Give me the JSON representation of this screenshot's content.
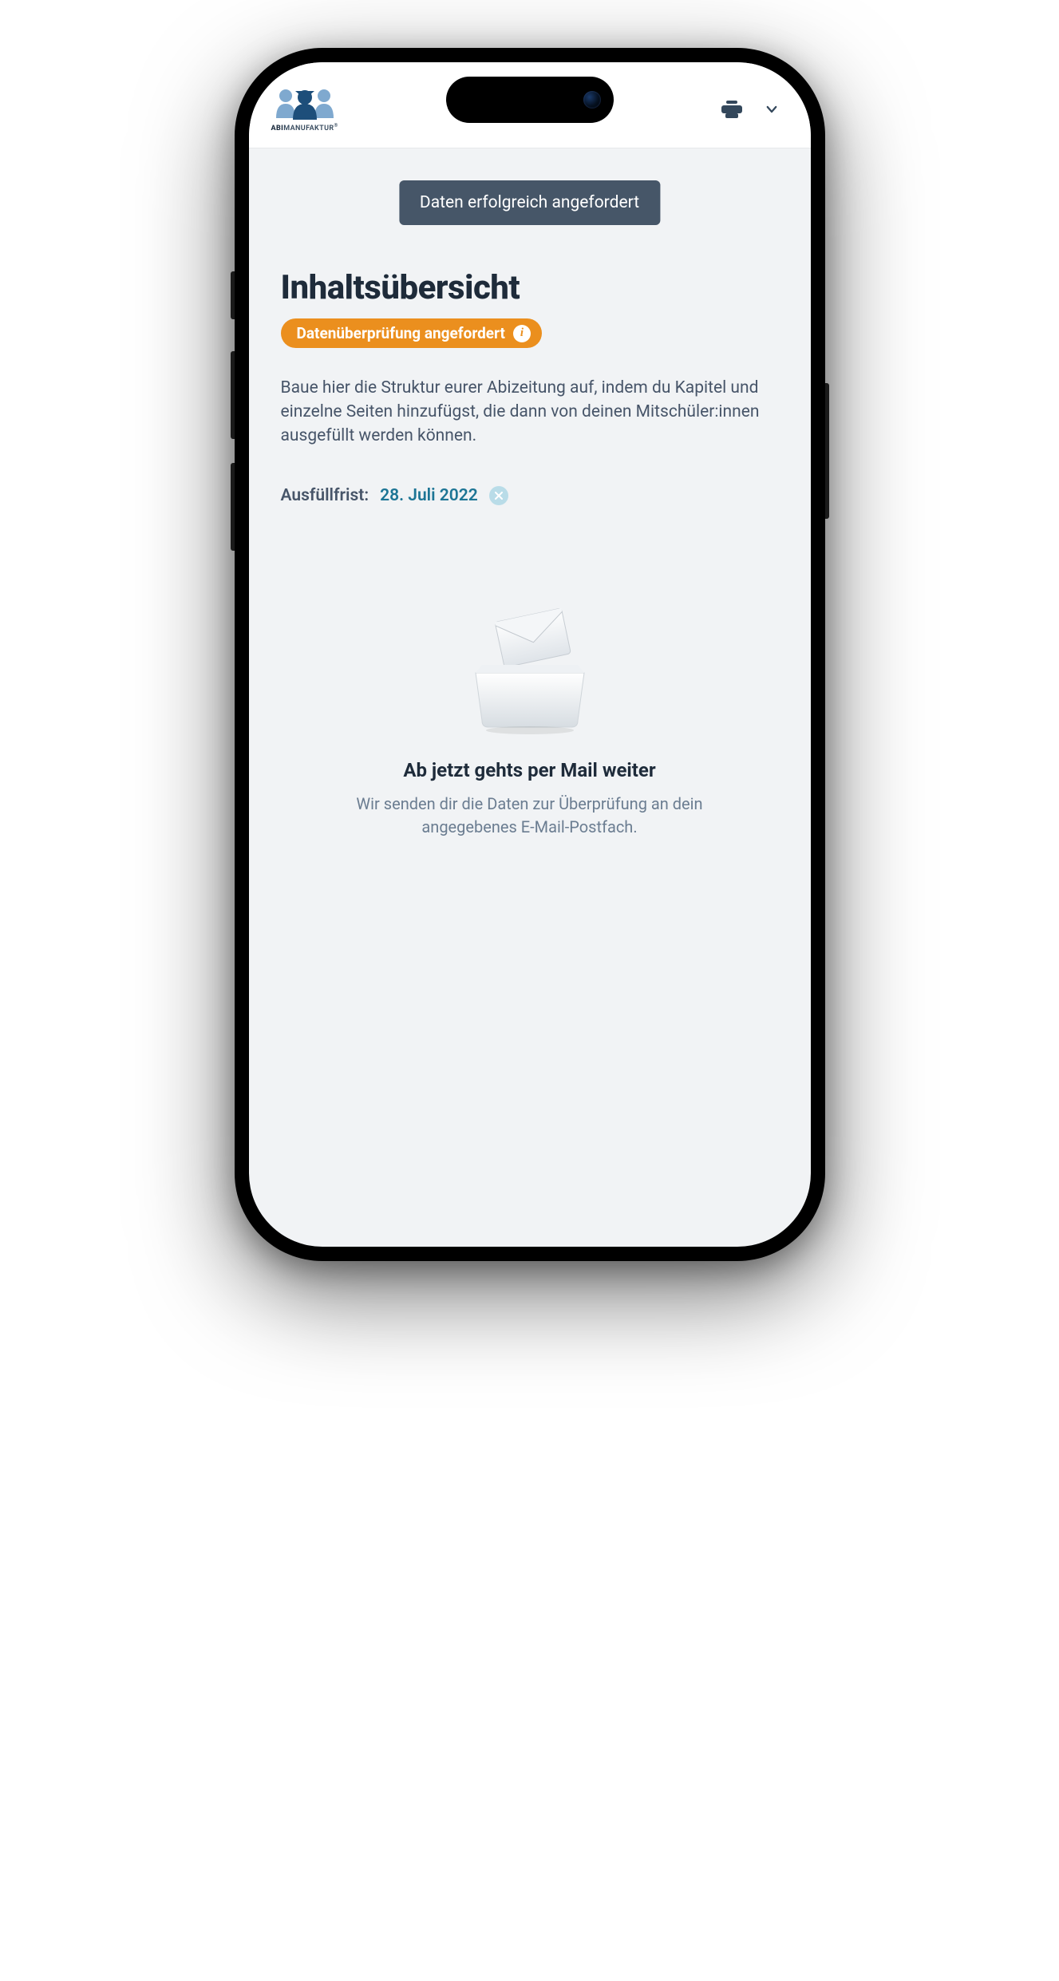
{
  "header": {
    "logo_text_bold": "ABI",
    "logo_text_rest": "MANUFAKTUR"
  },
  "toast": {
    "message": "Daten erfolgreich angefordert"
  },
  "page": {
    "title": "Inhaltsübersicht",
    "badge_label": "Datenüberprüfung angefordert",
    "description": "Baue hier die Struktur eurer Abizeitung auf, indem du Kapitel und einzelne Seiten hinzufügst, die dann von deinen Mitschüler:innen ausgefüllt werden können."
  },
  "deadline": {
    "label": "Ausfüllfrist:",
    "value": "28. Juli 2022"
  },
  "mail": {
    "heading": "Ab jetzt gehts per Mail weiter",
    "text": "Wir senden dir die Daten zur Überprüfung an dein angegebenes E-Mail-Postfach."
  }
}
